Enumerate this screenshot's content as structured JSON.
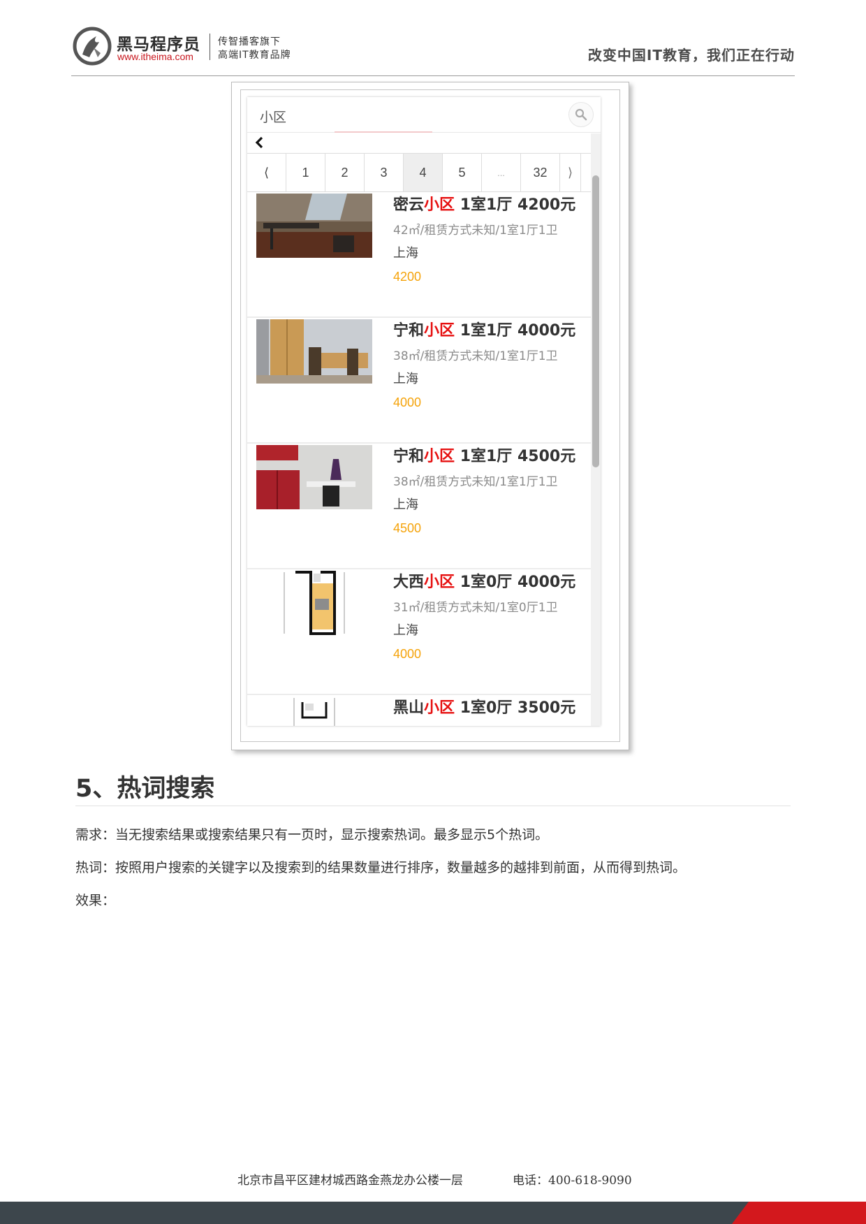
{
  "header": {
    "brand_name": "黑马程序员",
    "brand_url": "www.itheima.com",
    "slogan_line1": "传智播客旗下",
    "slogan_line2": "高端IT教育品牌",
    "motto": "改变中国IT教育，我们正在行动"
  },
  "screenshot": {
    "search": {
      "value": "小区",
      "icon": "search-icon"
    },
    "back_icon": "chevron-left-icon",
    "pagination": [
      "⟨",
      "1",
      "2",
      "3",
      "4",
      "5",
      "...",
      "32",
      "⟩"
    ],
    "active_page": "4",
    "listings": [
      {
        "title_prefix": "密云",
        "title_highlight": "小区",
        "title_suffix": " 1室1厅 4200元",
        "desc": "42㎡/租赁方式未知/1室1厅1卫",
        "city": "上海",
        "price": "4200",
        "image": "room-photo"
      },
      {
        "title_prefix": "宁和",
        "title_highlight": "小区",
        "title_suffix": " 1室1厅 4000元",
        "desc": "38㎡/租赁方式未知/1室1厅1卫",
        "city": "上海",
        "price": "4000",
        "image": "room-photo"
      },
      {
        "title_prefix": "宁和",
        "title_highlight": "小区",
        "title_suffix": " 1室1厅 4500元",
        "desc": "38㎡/租赁方式未知/1室1厅1卫",
        "city": "上海",
        "price": "4500",
        "image": "room-photo"
      },
      {
        "title_prefix": "大西",
        "title_highlight": "小区",
        "title_suffix": " 1室0厅 4000元",
        "desc": "31㎡/租赁方式未知/1室0厅1卫",
        "city": "上海",
        "price": "4000",
        "image": "floor-plan"
      },
      {
        "title_prefix": "黑山",
        "title_highlight": "小区",
        "title_suffix": " 1室0厅 3500元",
        "desc": "",
        "city": "",
        "price": "",
        "image": "floor-plan"
      }
    ]
  },
  "section": {
    "heading": "5、热词搜索",
    "requirement": "需求：当无搜索结果或搜索结果只有一页时，显示搜索热词。最多显示5个热词。",
    "hotwords": "热词：按照用户搜索的关键字以及搜索到的结果数量进行排序，数量越多的越排到前面，从而得到热词。",
    "effect": "效果："
  },
  "footer": {
    "address": "北京市昌平区建材城西路金燕龙办公楼一层",
    "phone": "电话：400-618-9090"
  },
  "colors": {
    "highlight": "#e60f0f",
    "price": "#f5a30a",
    "footer_bar": "#3d464c",
    "footer_accent": "#d3181d"
  }
}
